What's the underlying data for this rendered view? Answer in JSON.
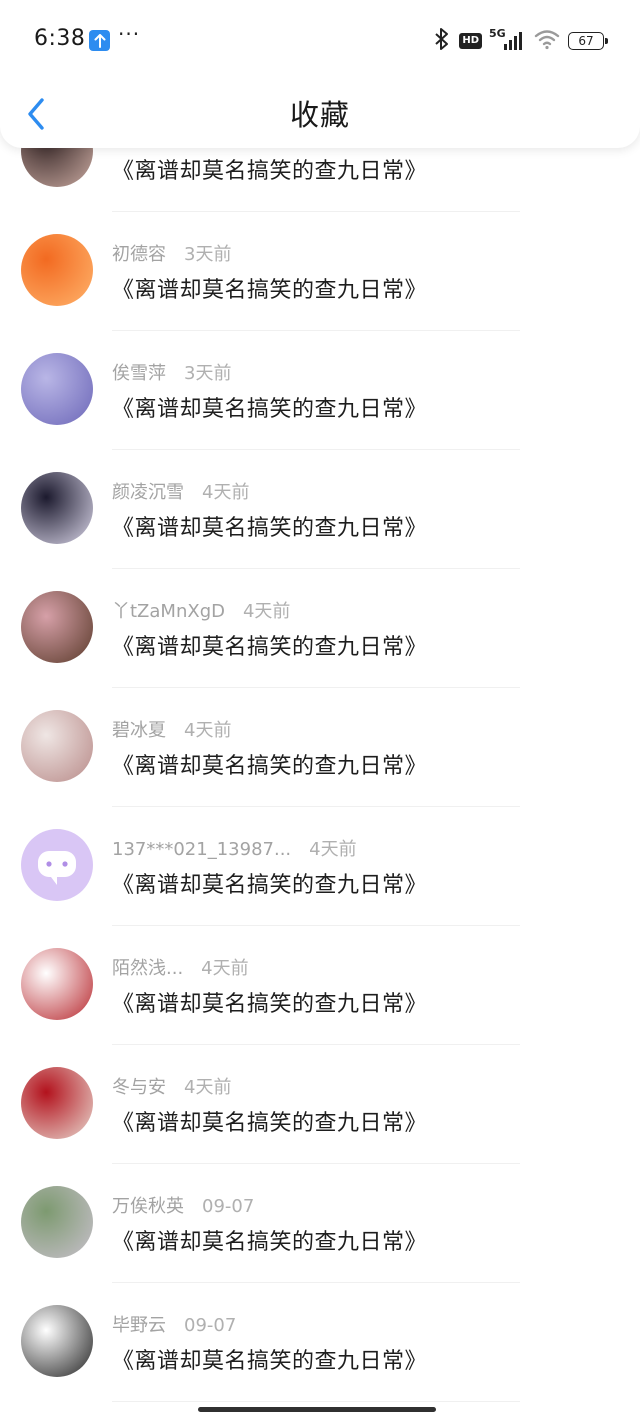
{
  "status_bar": {
    "time": "6:38",
    "more": "···",
    "network_label": "5G",
    "hd_label": "HD",
    "battery": "67"
  },
  "header": {
    "back_icon": "chevron-left-icon",
    "title": "收藏"
  },
  "favorites": [
    {
      "user": "",
      "time": "",
      "content": "《离谱却莫名搞笑的查九日常》",
      "avatar_colors": [
        "#3a2a2a",
        "#c9a9a0"
      ]
    },
    {
      "user": "初德容",
      "time": "3天前",
      "content": "《离谱却莫名搞笑的查九日常》",
      "avatar_colors": [
        "#f26a21",
        "#ffb36b"
      ]
    },
    {
      "user": "俟雪萍",
      "time": "3天前",
      "content": "《离谱却莫名搞笑的查九日常》",
      "avatar_colors": [
        "#b9b6e6",
        "#6c67b8"
      ]
    },
    {
      "user": "颜凌沉雪",
      "time": "4天前",
      "content": "《离谱却莫名搞笑的查九日常》",
      "avatar_colors": [
        "#1c1a2e",
        "#d9d5e8"
      ]
    },
    {
      "user": "丫tZaMnXgD",
      "time": "4天前",
      "content": "《离谱却莫名搞笑的查九日常》",
      "avatar_colors": [
        "#d6a0a8",
        "#5a3a2a"
      ]
    },
    {
      "user": "碧冰夏",
      "time": "4天前",
      "content": "《离谱却莫名搞笑的查九日常》",
      "avatar_colors": [
        "#efe6e4",
        "#b88a88"
      ]
    },
    {
      "user": "137***021_13987...",
      "time": "4天前",
      "content": "《离谱却莫名搞笑的查九日常》",
      "avatar_colors": [
        "#d9c6f5",
        "#d9c6f5"
      ]
    },
    {
      "user": "陌然浅...",
      "time": "4天前",
      "content": "《离谱却莫名搞笑的查九日常》",
      "avatar_colors": [
        "#ffffff",
        "#b7282e"
      ]
    },
    {
      "user": "冬与安",
      "time": "4天前",
      "content": "《离谱却莫名搞笑的查九日常》",
      "avatar_colors": [
        "#b3121d",
        "#e8d9d0"
      ]
    },
    {
      "user": "万俟秋英",
      "time": "09-07",
      "content": "《离谱却莫名搞笑的查九日常》",
      "avatar_colors": [
        "#7d9a70",
        "#c8c0cc"
      ]
    },
    {
      "user": "毕野云",
      "time": "09-07",
      "content": "《离谱却莫名搞笑的查九日常》",
      "avatar_colors": [
        "#ffffff",
        "#222222"
      ]
    }
  ]
}
